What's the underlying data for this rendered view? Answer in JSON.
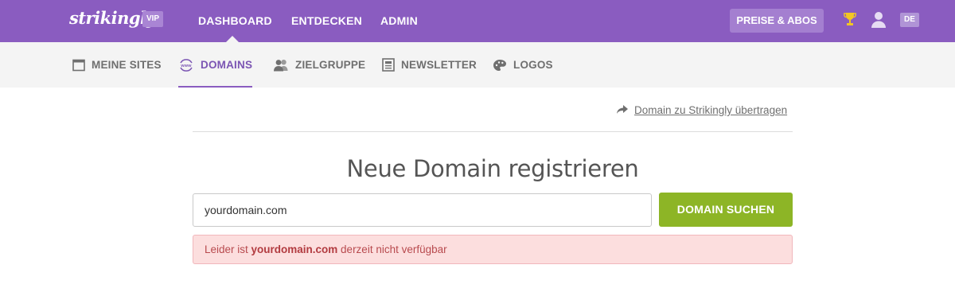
{
  "topbar": {
    "logo": "strikingly",
    "badge": "VIP",
    "nav": [
      "DASHBOARD",
      "ENTDECKEN",
      "ADMIN"
    ],
    "pricing_label": "PREISE & ABOS",
    "language": "DE"
  },
  "subnav": {
    "items": [
      {
        "label": "MEINE SITES",
        "icon": "browser-window-icon"
      },
      {
        "label": "DOMAINS",
        "icon": "www-globe-icon",
        "active": true
      },
      {
        "label": "ZIELGRUPPE",
        "icon": "people-icon"
      },
      {
        "label": "NEWSLETTER",
        "icon": "newsletter-icon"
      },
      {
        "label": "LOGOS",
        "icon": "palette-icon"
      }
    ]
  },
  "main": {
    "transfer_link": "Domain zu Strikingly übertragen",
    "title": "Neue Domain registrieren",
    "search_value": "yourdomain.com",
    "search_button": "DOMAIN SUCHEN",
    "alert": {
      "prefix": "Leider ist ",
      "domain": "yourdomain.com",
      "suffix": " derzeit nicht verfügbar"
    }
  },
  "colors": {
    "brand_purple": "#8a5cc0",
    "action_green": "#8db526",
    "alert_bg": "#fcdede",
    "alert_text": "#b84a4e"
  }
}
